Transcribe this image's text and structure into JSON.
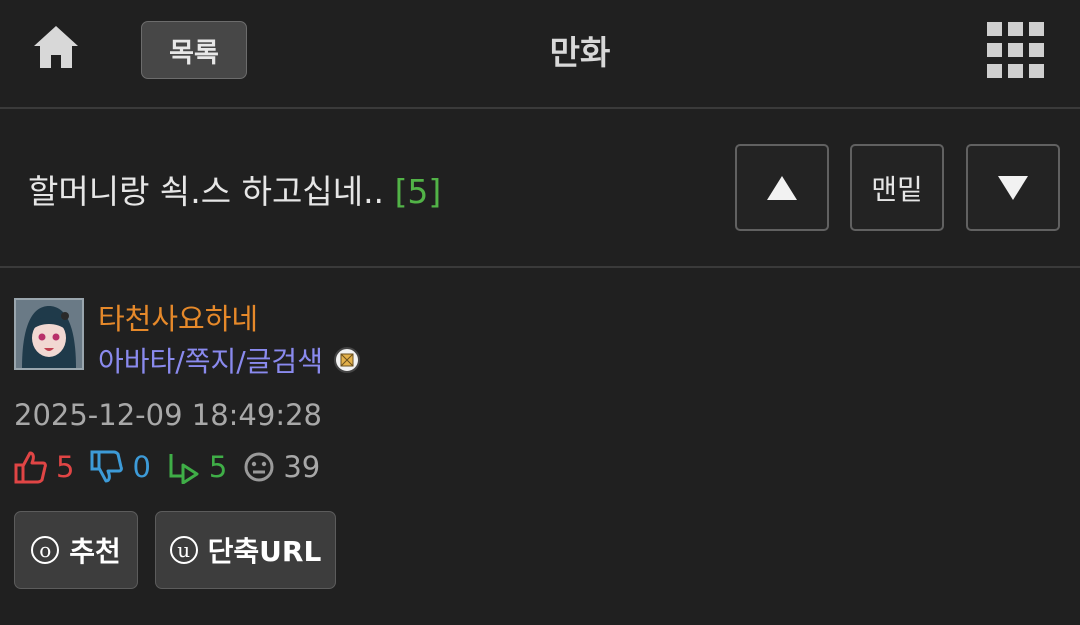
{
  "header": {
    "home_icon": "home-icon",
    "list_label": "목록",
    "title": "만화",
    "menu_icon": "grid-menu-icon"
  },
  "post": {
    "title": "할머니랑 쇡.스 하고십네..",
    "comment_count": "[5]",
    "nav_up_icon": "arrow-up-icon",
    "nav_bottom_label": "맨밑",
    "nav_down_icon": "arrow-down-icon"
  },
  "author": {
    "name": "타천사요하네",
    "links": "아바타/쪽지/글검색",
    "name_color": "#e6892a",
    "links_color": "#8a8aee"
  },
  "date": "2025-12-09 18:49:28",
  "stats": {
    "upvotes": "5",
    "downvotes": "0",
    "replies": "5",
    "views": "39",
    "upvote_color": "#e04545",
    "downvote_color": "#3d9bd8",
    "reply_color": "#3fae47"
  },
  "actions": {
    "recommend_key": "o",
    "recommend_label": "추천",
    "shorturl_key": "u",
    "shorturl_label": "단축URL"
  }
}
